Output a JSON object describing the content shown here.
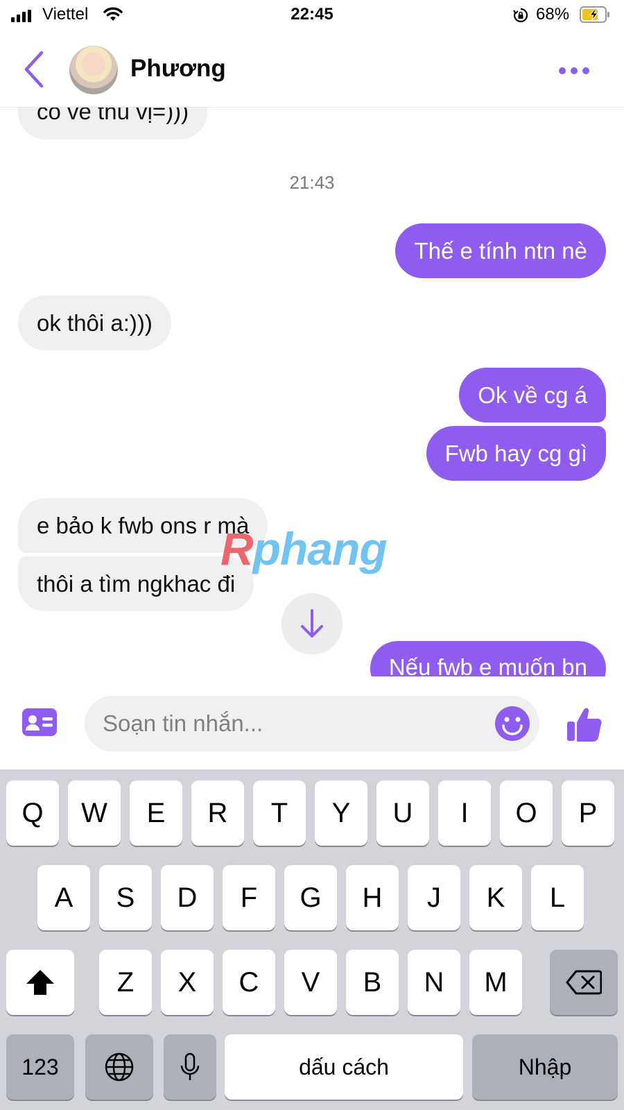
{
  "status_bar": {
    "carrier": "Viettel",
    "time": "22:45",
    "battery_percent": "68%"
  },
  "header": {
    "contact_name": "Phương",
    "back_icon": "chevron-left-icon",
    "more_icon": "more-horizontal-icon"
  },
  "messages": [
    {
      "direction": "in",
      "text": "co ve thu vị=)))"
    },
    {
      "type": "timestamp",
      "text": "21:43"
    },
    {
      "direction": "out",
      "text": "Thế e tính ntn nè"
    },
    {
      "direction": "in",
      "text": "ok thôi a:)))"
    },
    {
      "direction": "out",
      "text": "Ok về cg á"
    },
    {
      "direction": "out",
      "text": "Fwb hay cg gì"
    },
    {
      "direction": "in",
      "text": "e bảo k fwb ons r mà"
    },
    {
      "direction": "in",
      "text": "thôi a tìm ngkhac đi"
    },
    {
      "direction": "out",
      "text": "Nếu fwb e muốn bn"
    }
  ],
  "watermark": {
    "first": "R",
    "rest": "phang"
  },
  "composer": {
    "placeholder": "Soạn tin nhắn...",
    "icons": [
      "contact-card-icon",
      "emoji-icon",
      "thumbs-up-icon"
    ]
  },
  "keyboard": {
    "row1": [
      "Q",
      "W",
      "E",
      "R",
      "T",
      "Y",
      "U",
      "I",
      "O",
      "P"
    ],
    "row2": [
      "A",
      "S",
      "D",
      "F",
      "G",
      "H",
      "J",
      "K",
      "L"
    ],
    "row3": [
      "Z",
      "X",
      "C",
      "V",
      "B",
      "N",
      "M"
    ],
    "numbers_key": "123",
    "space_key": "dấu cách",
    "return_key": "Nhập"
  },
  "colors": {
    "accent": "#8f5cf0",
    "incoming_bubble": "#f0f0f2",
    "keyboard_bg": "#d2d4d9"
  }
}
